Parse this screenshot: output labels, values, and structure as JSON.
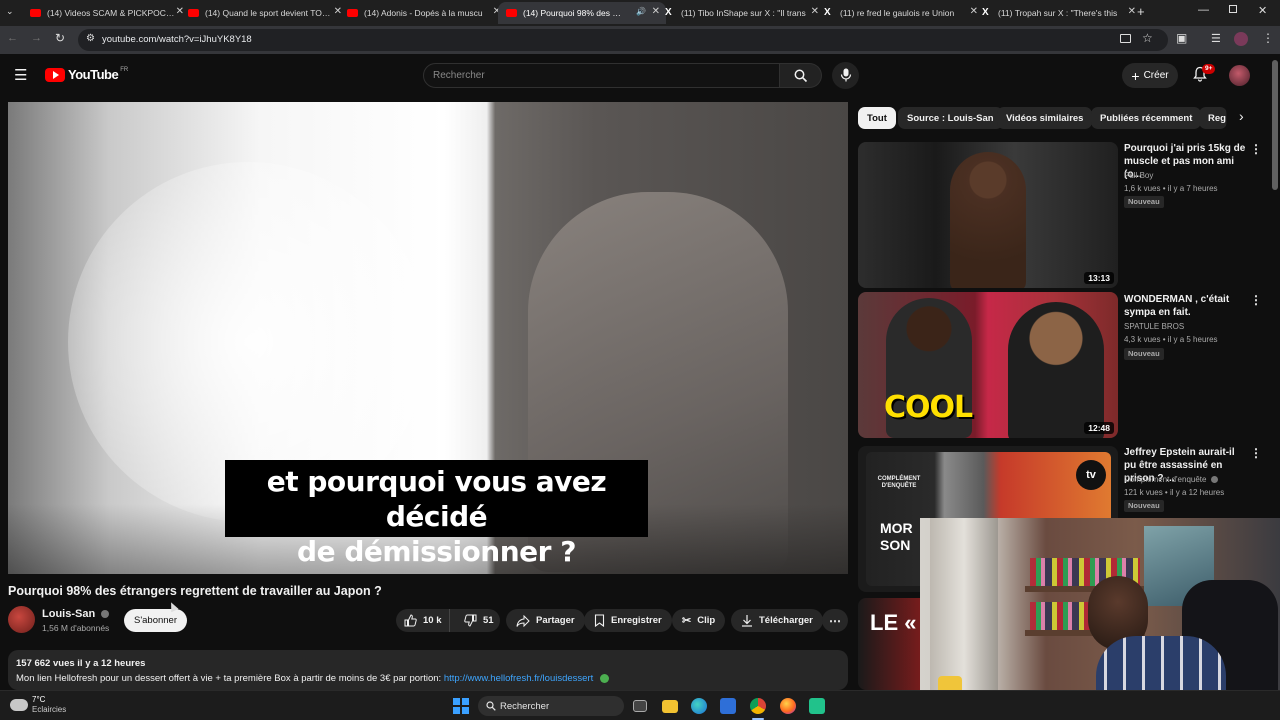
{
  "browser": {
    "tabs": [
      {
        "title": "(14) Videos SCAM & PICKPOCKET",
        "icon": "youtube-icon"
      },
      {
        "title": "(14) Quand le sport devient TOXIQUE",
        "icon": "youtube-icon"
      },
      {
        "title": "(14) Adonis - Dopés à la muscu",
        "icon": "youtube-icon"
      },
      {
        "title": "(14) Pourquoi 98% des étrangers",
        "icon": "youtube-icon",
        "active": true
      },
      {
        "title": "(11) Tibo InShape sur X : \"Il trans",
        "icon": "x-icon"
      },
      {
        "title": "(11) re fred le gaulois re Union",
        "icon": "x-icon"
      },
      {
        "title": "(11) Tropah sur X : \"There's this",
        "icon": "x-icon"
      }
    ],
    "url": "youtube.com/watch?v=iJhuYK8Y18"
  },
  "youtube_header": {
    "logo_text": "YouTube",
    "region": "FR",
    "search_placeholder": "Rechercher",
    "create_label": "Créer",
    "notification_count": "9+"
  },
  "video": {
    "subtitle_line1": "et pourquoi vous avez décidé",
    "subtitle_line2": "de démissionner ?",
    "title": "Pourquoi 98% des étrangers regrettent de travailler au Japon ?"
  },
  "channel": {
    "name": "Louis-San",
    "subscribers": "1,56 M d'abonnés",
    "subscribe_label": "S'abonner"
  },
  "actions": {
    "likes": "10 k",
    "dislikes": "51",
    "share": "Partager",
    "save": "Enregistrer",
    "clip": "Clip",
    "download": "Télécharger"
  },
  "description": {
    "views_time": "157 662 vues  il y a 12 heures",
    "text": "Mon lien Hellofresh pour un dessert offert à vie + ta première Box à partir de moins de 3€ par portion: ",
    "link": "http://www.hellofresh.fr/louisdessert"
  },
  "chips": [
    "Tout",
    "Source : Louis-San",
    "Vidéos similaires",
    "Publiées récemment",
    "Reg"
  ],
  "recommendations": [
    {
      "title": "Pourquoi j'ai pris 15kg de muscle et pas mon ami (o...",
      "channel": "Pull Boy",
      "meta": "1,6 k vues • il y a 7 heures",
      "badge": "Nouveau",
      "duration": "13:13"
    },
    {
      "title": "WONDERMAN , c'était sympa en fait.",
      "channel": "SPATULE BROS",
      "meta": "4,3 k vues • il y a 5 heures",
      "badge": "Nouveau",
      "duration": "12:48",
      "thumb_text": "COOL"
    },
    {
      "title": "Jeffrey Epstein aurait-il pu être assassiné en prison ? ...",
      "channel": "Complément d'enquête",
      "meta": "121 k vues • il y a 12 heures",
      "badge": "Nouveau",
      "thumb_text": "MOR SON",
      "thumb_logo": "COMPLÉMENT D'ENQUÊTE",
      "thumb_tv": "tv"
    },
    {
      "thumb_text": "LE «"
    }
  ],
  "taskbar": {
    "temperature": "7°C",
    "weather": "Eclaircies",
    "search_label": "Rechercher"
  },
  "colors": {
    "youtube_red": "#ff0000",
    "link_blue": "#3ea6ff",
    "background": "#0f0f0f"
  }
}
